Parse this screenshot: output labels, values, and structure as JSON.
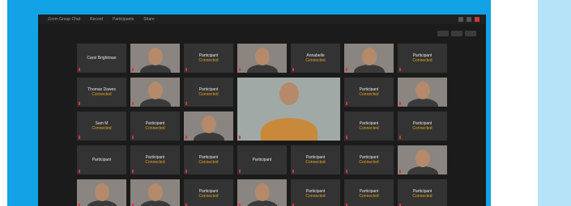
{
  "caption": "",
  "window": {
    "menu": [
      "Zoom Group Chat",
      "Record",
      "Participants",
      "Share"
    ],
    "controls": [
      "minimize-icon",
      "maximize-icon",
      "close-icon"
    ],
    "view_buttons": [
      "speaker-view-icon",
      "gallery-view-icon",
      "fullscreen-icon"
    ]
  },
  "participants": [
    {
      "name": "Carol Brightman",
      "status": "",
      "video": false
    },
    {
      "name": "",
      "status": "",
      "video": true
    },
    {
      "name": "Participant",
      "status": "Connected",
      "video": false
    },
    {
      "name": "",
      "status": "",
      "video": true
    },
    {
      "name": "Annabelle",
      "status": "Connected",
      "video": false
    },
    {
      "name": "",
      "status": "",
      "video": true
    },
    {
      "name": "Participant",
      "status": "Connected",
      "video": false
    },
    {
      "name": "Thomas Dawes",
      "status": "Connected",
      "video": false
    },
    {
      "name": "",
      "status": "",
      "video": true
    },
    {
      "name": "Participant",
      "status": "Connected",
      "video": false
    },
    {
      "name": "",
      "status": "",
      "video": true,
      "big": true
    },
    {
      "name": "Participant",
      "status": "Connected",
      "video": false
    },
    {
      "name": "",
      "status": "",
      "video": true
    },
    {
      "name": "Sam M",
      "status": "Connected",
      "video": false
    },
    {
      "name": "Participant",
      "status": "Connected",
      "video": false
    },
    {
      "name": "",
      "status": "",
      "video": true
    },
    {
      "name": "Participant",
      "status": "Connected",
      "video": false
    },
    {
      "name": "Participant",
      "status": "Connected",
      "video": false
    },
    {
      "name": "Participant",
      "status": "",
      "video": false
    },
    {
      "name": "Participant",
      "status": "Connected",
      "video": false
    },
    {
      "name": "Participant",
      "status": "Connected",
      "video": false
    },
    {
      "name": "Participant",
      "status": "",
      "video": false
    },
    {
      "name": "Participant",
      "status": "Connected",
      "video": false
    },
    {
      "name": "Participant",
      "status": "Connected",
      "video": false
    },
    {
      "name": "",
      "status": "",
      "video": true
    },
    {
      "name": "",
      "status": "",
      "video": true
    },
    {
      "name": "",
      "status": "",
      "video": true
    },
    {
      "name": "Participant",
      "status": "Connected",
      "video": false
    },
    {
      "name": "",
      "status": "",
      "video": true
    },
    {
      "name": "Participant",
      "status": "Connected",
      "video": false
    },
    {
      "name": "Participant",
      "status": "Connected",
      "video": false
    },
    {
      "name": "Participant",
      "status": "Connected",
      "video": false
    }
  ]
}
